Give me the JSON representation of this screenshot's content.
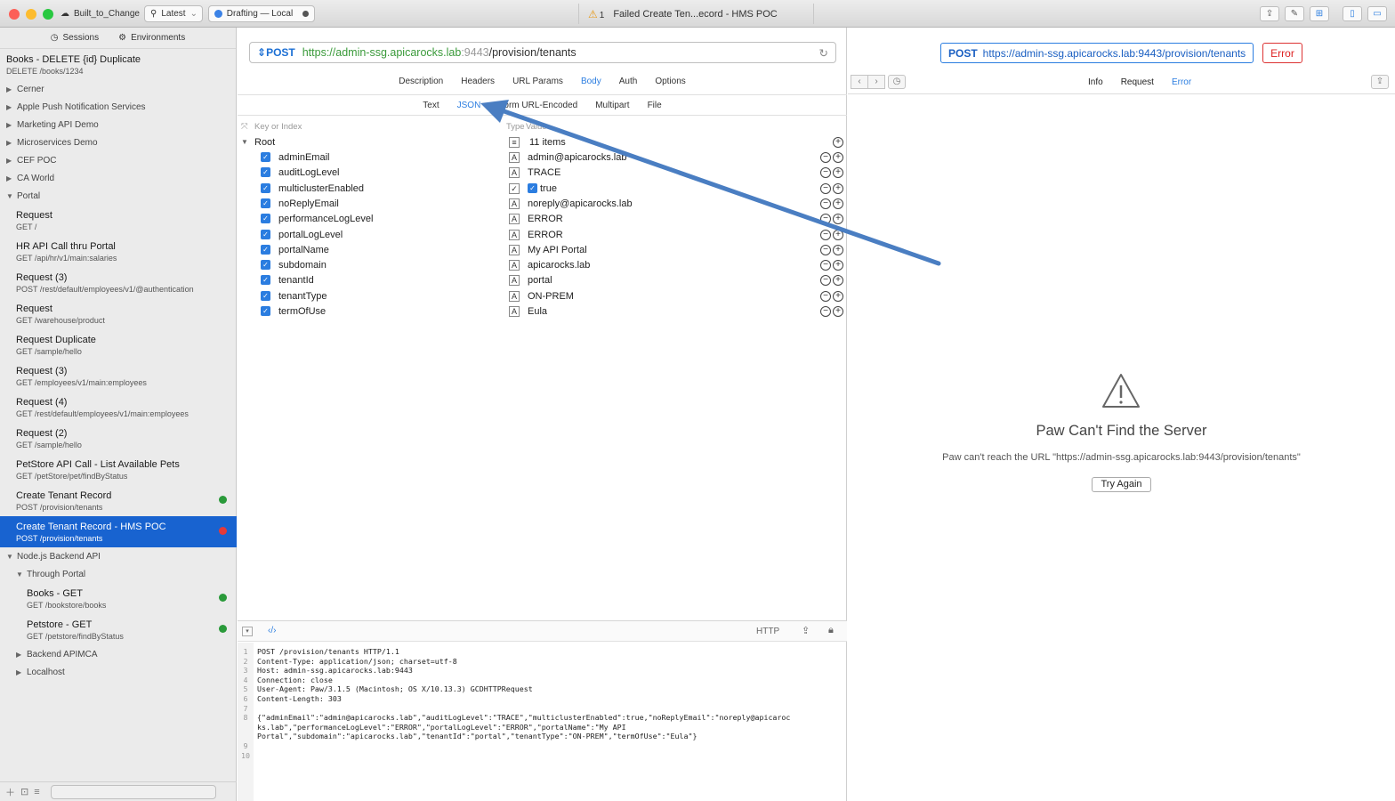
{
  "titlebar": {
    "project": "Built_to_Change",
    "version": "Latest",
    "branch": "Drafting — Local",
    "warning_count": "1",
    "window_title": "Failed Create Ten...ecord - HMS POC"
  },
  "sidebar": {
    "tabs": [
      "Sessions",
      "Environments"
    ],
    "top_item": {
      "name": "Books - DELETE {id} Duplicate",
      "url": "DELETE /books/1234"
    },
    "groups_before": [
      "Cerner",
      "Apple Push Notification Services",
      "Marketing API Demo",
      "Microservices Demo",
      "CEF POC",
      "CA World"
    ],
    "portal_group": "Portal",
    "portal_items": [
      {
        "name": "Request",
        "url": "GET /"
      },
      {
        "name": "HR API Call thru Portal",
        "url": "GET /api/hr/v1/main:salaries"
      },
      {
        "name": "Request (3)",
        "url": "POST /rest/default/employees/v1/@authentication"
      },
      {
        "name": "Request",
        "url": "GET /warehouse/product"
      },
      {
        "name": "Request Duplicate",
        "url": "GET /sample/hello"
      },
      {
        "name": "Request (3)",
        "url": "GET /employees/v1/main:employees"
      },
      {
        "name": "Request (4)",
        "url": "GET /rest/default/employees/v1/main:employees"
      },
      {
        "name": "Request (2)",
        "url": "GET /sample/hello"
      },
      {
        "name": "PetStore API Call - List Available Pets",
        "url": "GET /petStore/pet/findByStatus"
      },
      {
        "name": "Create Tenant Record",
        "url": "POST /provision/tenants"
      },
      {
        "name": "Create Tenant Record - HMS POC",
        "url": "POST /provision/tenants"
      }
    ],
    "node_group": "Node.js Backend API",
    "through_portal": "Through Portal",
    "tp_items": [
      {
        "name": "Books - GET",
        "url": "GET /bookstore/books"
      },
      {
        "name": "Petstore - GET",
        "url": "GET /petstore/findByStatus"
      }
    ],
    "groups_after": [
      "Backend APIMCA",
      "Localhost"
    ]
  },
  "request": {
    "method": "POST",
    "url_scheme": "https://",
    "url_host": "admin-ssg.apicarocks.lab",
    "url_port": ":9443",
    "url_path": "/provision/tenants",
    "tabs": [
      "Description",
      "Headers",
      "URL Params",
      "Body",
      "Auth",
      "Options"
    ],
    "body_tabs": [
      "Text",
      "JSON",
      "Form URL-Encoded",
      "Multipart",
      "File"
    ],
    "kv_placeholder": "Key or Index",
    "type_placeholder": "Type",
    "value_placeholder": "Value",
    "root_label": "Root",
    "root_count": "11 items",
    "fields": [
      {
        "key": "adminEmail",
        "type": "A",
        "value": "admin@apicarocks.lab"
      },
      {
        "key": "auditLogLevel",
        "type": "A",
        "value": "TRACE"
      },
      {
        "key": "multiclusterEnabled",
        "type": "✓",
        "value": "true"
      },
      {
        "key": "noReplyEmail",
        "type": "A",
        "value": "noreply@apicarocks.lab"
      },
      {
        "key": "performanceLogLevel",
        "type": "A",
        "value": "ERROR"
      },
      {
        "key": "portalLogLevel",
        "type": "A",
        "value": "ERROR"
      },
      {
        "key": "portalName",
        "type": "A",
        "value": "My API Portal"
      },
      {
        "key": "subdomain",
        "type": "A",
        "value": "apicarocks.lab"
      },
      {
        "key": "tenantId",
        "type": "A",
        "value": "portal"
      },
      {
        "key": "tenantType",
        "type": "A",
        "value": "ON-PREM"
      },
      {
        "key": "termOfUse",
        "type": "A",
        "value": "Eula"
      }
    ],
    "code_format": "HTTP",
    "raw_lines": [
      "POST /provision/tenants HTTP/1.1",
      "Content-Type: application/json; charset=utf-8",
      "Host: admin-ssg.apicarocks.lab:9443",
      "Connection: close",
      "User-Agent: Paw/3.1.5 (Macintosh; OS X/10.13.3) GCDHTTPRequest",
      "Content-Length: 303",
      "",
      "{\"adminEmail\":\"admin@apicarocks.lab\",\"auditLogLevel\":\"TRACE\",\"multiclusterEnabled\":true,\"noReplyEmail\":\"noreply@apicaroc",
      "ks.lab\",\"performanceLogLevel\":\"ERROR\",\"portalLogLevel\":\"ERROR\",\"portalName\":\"My API",
      "Portal\",\"subdomain\":\"apicarocks.lab\",\"tenantId\":\"portal\",\"tenantType\":\"ON-PREM\",\"termOfUse\":\"Eula\"}"
    ],
    "line_numbers": [
      "1",
      "2",
      "3",
      "4",
      "5",
      "6",
      "7",
      "8",
      "",
      "",
      "9",
      "10"
    ]
  },
  "response": {
    "method": "POST",
    "url": "https://admin-ssg.apicarocks.lab:9443/provision/tenants",
    "status": "Error",
    "tabs": [
      "Info",
      "Request",
      "Error"
    ],
    "error_title": "Paw Can't Find the Server",
    "error_message": "Paw can't reach the URL \"https://admin-ssg.apicarocks.lab:9443/provision/tenants\"",
    "retry_label": "Try Again"
  },
  "colors": {
    "accent": "#1863d0",
    "link": "#2b7de0",
    "error": "#d22222",
    "green_dot": "#2a9a3a",
    "red_dot": "#e43a3a",
    "annotation_arrow": "#4a7ec2"
  }
}
